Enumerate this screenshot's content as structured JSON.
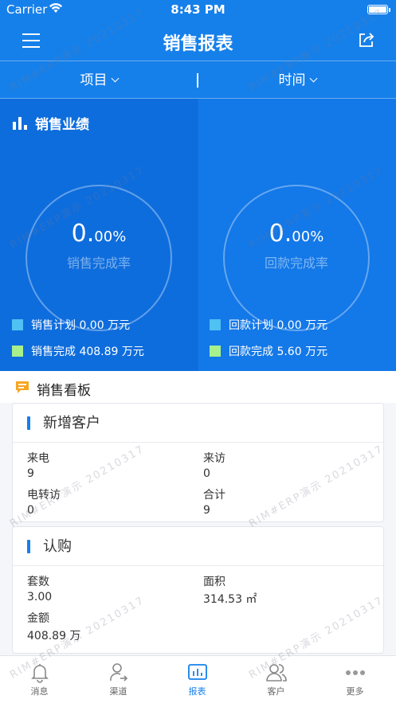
{
  "status": {
    "carrier": "Carrier",
    "time": "8:43 PM"
  },
  "nav": {
    "title": "销售报表"
  },
  "filters": {
    "project": "项目",
    "time": "时间"
  },
  "performance": {
    "heading": "销售业绩",
    "sales": {
      "value_int": "0.",
      "value_dec": "00%",
      "label": "销售完成率",
      "plan_label": "销售计划 0.00 万元",
      "done_label": "销售完成 408.89 万元",
      "plan_color": "#4fc1f2",
      "done_color": "#a8f08c"
    },
    "payment": {
      "value_int": "0.",
      "value_dec": "00%",
      "label": "回款完成率",
      "plan_label": "回款计划 0.00 万元",
      "done_label": "回款完成 5.60 万元",
      "plan_color": "#4fc1f2",
      "done_color": "#a8f08c"
    }
  },
  "board": {
    "title": "销售看板"
  },
  "new_customers": {
    "title": "新增客户",
    "call_label": "来电",
    "call_value": "9",
    "visit_label": "来访",
    "visit_value": "0",
    "transfer_label": "电转访",
    "transfer_value": "0",
    "total_label": "合计",
    "total_value": "9"
  },
  "subscription": {
    "title": "认购",
    "sets_label": "套数",
    "sets_value": "3.00",
    "area_label": "面积",
    "area_value": "314.53 ㎡",
    "amount_label": "金额",
    "amount_value": "408.89 万"
  },
  "tabbar": {
    "messages": "消息",
    "channels": "渠道",
    "reports": "报表",
    "customers": "客户",
    "more": "更多"
  },
  "watermark": "RIM#ERP演示 20210317",
  "colors": {
    "brand": "#1680ea",
    "active_tab": "#1680ea"
  }
}
